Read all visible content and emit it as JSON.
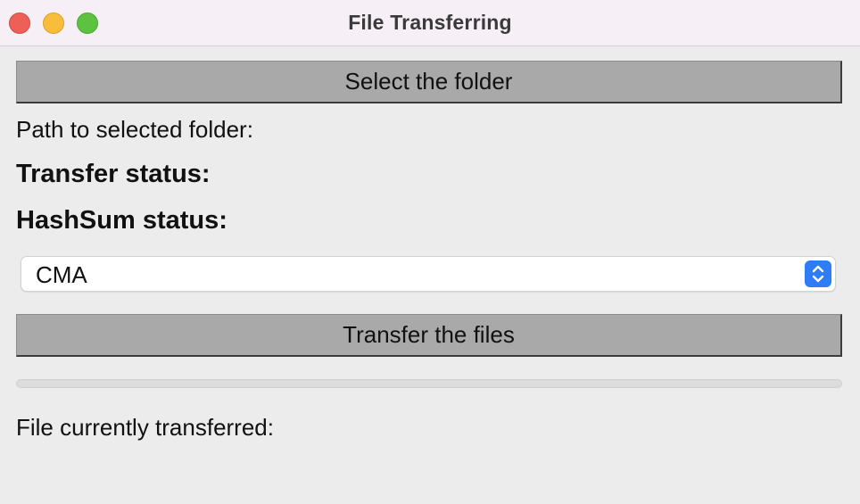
{
  "window": {
    "title": "File Transferring"
  },
  "buttons": {
    "select_folder": "Select the folder",
    "transfer_files": "Transfer the files"
  },
  "labels": {
    "path": "Path to selected folder:",
    "transfer_status": "Transfer status:",
    "hashsum_status": "HashSum status:",
    "current_file": "File currently transferred:"
  },
  "dropdown": {
    "selected": "CMA"
  },
  "progress": {
    "value": 0
  },
  "colors": {
    "accent": "#2e7cf6",
    "close": "#ee5f58",
    "minimize": "#f8bd3b",
    "zoom": "#5ec241"
  }
}
